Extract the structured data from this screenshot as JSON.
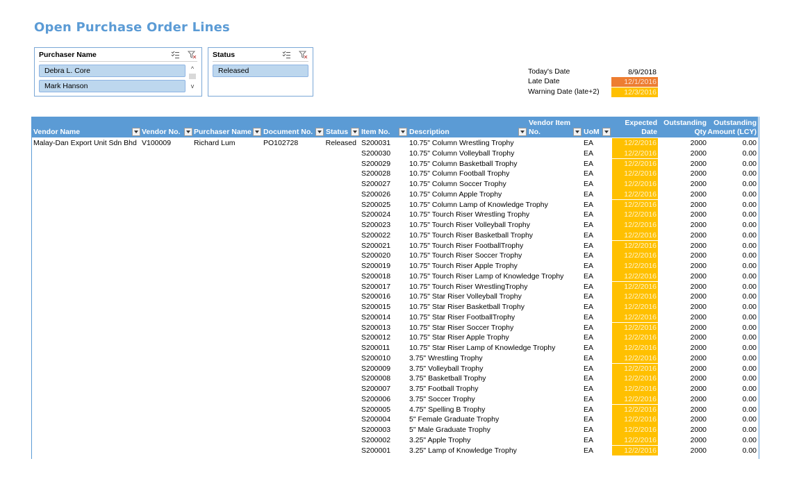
{
  "title": "Open Purchase Order Lines",
  "slicers": {
    "purchaser": {
      "header": "Purchaser Name",
      "items": [
        "Debra L. Core",
        "Mark Hanson"
      ],
      "scroll_up": "^",
      "scroll_down": "v"
    },
    "status": {
      "header": "Status",
      "items": [
        "Released"
      ]
    }
  },
  "dates": {
    "today_label": "Today's Date",
    "today_value": "8/9/2018",
    "late_label": "Late Date",
    "late_value": "12/1/2016",
    "warning_label": "Warning Date (late+2)",
    "warning_value": "12/3/2016"
  },
  "colors": {
    "header_blue": "#5b9bd5",
    "late_orange": "#ed7d31",
    "warning_yellow": "#ffc000"
  },
  "table": {
    "columns": {
      "vendor_name": "Vendor Name",
      "vendor_no": "Vendor No.",
      "purchaser_name": "Purchaser Name",
      "document_no": "Document No.",
      "status": "Status",
      "item_no": "Item No.",
      "description": "Description",
      "vendor_item_no_1": "Vendor Item",
      "vendor_item_no_2": "No.",
      "uom": "UoM",
      "expected_date_1": "Expected",
      "expected_date_2": "Date",
      "outstanding_qty_1": "Outstanding",
      "outstanding_qty_2": "Qty",
      "outstanding_amount_1": "Outstanding",
      "outstanding_amount_2": "Amount (LCY)"
    },
    "first_row": {
      "vendor_name": "Malay-Dan Export Unit Sdn Bhd",
      "vendor_no": "V100009",
      "purchaser_name": "Richard Lum",
      "document_no": "PO102728",
      "status": "Released"
    },
    "rows": [
      {
        "item": "S200031",
        "desc": "10.75\" Column Wrestling Trophy",
        "uom": "EA",
        "date": "12/2/2016",
        "qty": "2000",
        "amount": "0.00"
      },
      {
        "item": "S200030",
        "desc": "10.75\" Column Volleyball Trophy",
        "uom": "EA",
        "date": "12/2/2016",
        "qty": "2000",
        "amount": "0.00"
      },
      {
        "item": "S200029",
        "desc": "10.75\" Column Basketball Trophy",
        "uom": "EA",
        "date": "12/2/2016",
        "qty": "2000",
        "amount": "0.00"
      },
      {
        "item": "S200028",
        "desc": "10.75\" Column Football Trophy",
        "uom": "EA",
        "date": "12/2/2016",
        "qty": "2000",
        "amount": "0.00"
      },
      {
        "item": "S200027",
        "desc": "10.75\" Column Soccer Trophy",
        "uom": "EA",
        "date": "12/2/2016",
        "qty": "2000",
        "amount": "0.00"
      },
      {
        "item": "S200026",
        "desc": "10.75\" Column Apple Trophy",
        "uom": "EA",
        "date": "12/2/2016",
        "qty": "2000",
        "amount": "0.00"
      },
      {
        "item": "S200025",
        "desc": "10.75\" Column Lamp of Knowledge Trophy",
        "uom": "EA",
        "date": "12/2/2016",
        "qty": "2000",
        "amount": "0.00"
      },
      {
        "item": "S200024",
        "desc": "10.75\" Tourch Riser Wrestling Trophy",
        "uom": "EA",
        "date": "12/2/2016",
        "qty": "2000",
        "amount": "0.00"
      },
      {
        "item": "S200023",
        "desc": "10.75\" Tourch Riser Volleyball Trophy",
        "uom": "EA",
        "date": "12/2/2016",
        "qty": "2000",
        "amount": "0.00"
      },
      {
        "item": "S200022",
        "desc": "10.75\" Tourch Riser Basketball Trophy",
        "uom": "EA",
        "date": "12/2/2016",
        "qty": "2000",
        "amount": "0.00"
      },
      {
        "item": "S200021",
        "desc": "10.75\" Tourch Riser FootballTrophy",
        "uom": "EA",
        "date": "12/2/2016",
        "qty": "2000",
        "amount": "0.00"
      },
      {
        "item": "S200020",
        "desc": "10.75\" Tourch Riser Soccer Trophy",
        "uom": "EA",
        "date": "12/2/2016",
        "qty": "2000",
        "amount": "0.00"
      },
      {
        "item": "S200019",
        "desc": "10.75\" Tourch Riser Apple Trophy",
        "uom": "EA",
        "date": "12/2/2016",
        "qty": "2000",
        "amount": "0.00"
      },
      {
        "item": "S200018",
        "desc": "10.75\" Tourch Riser Lamp of Knowledge Trophy",
        "uom": "EA",
        "date": "12/2/2016",
        "qty": "2000",
        "amount": "0.00"
      },
      {
        "item": "S200017",
        "desc": "10.75\" Tourch Riser WrestlingTrophy",
        "uom": "EA",
        "date": "12/2/2016",
        "qty": "2000",
        "amount": "0.00"
      },
      {
        "item": "S200016",
        "desc": "10.75\" Star Riser Volleyball Trophy",
        "uom": "EA",
        "date": "12/2/2016",
        "qty": "2000",
        "amount": "0.00"
      },
      {
        "item": "S200015",
        "desc": "10.75\" Star Riser Basketball Trophy",
        "uom": "EA",
        "date": "12/2/2016",
        "qty": "2000",
        "amount": "0.00"
      },
      {
        "item": "S200014",
        "desc": "10.75\" Star Riser FootballTrophy",
        "uom": "EA",
        "date": "12/2/2016",
        "qty": "2000",
        "amount": "0.00"
      },
      {
        "item": "S200013",
        "desc": "10.75\" Star Riser Soccer Trophy",
        "uom": "EA",
        "date": "12/2/2016",
        "qty": "2000",
        "amount": "0.00"
      },
      {
        "item": "S200012",
        "desc": "10.75\" Star Riser Apple Trophy",
        "uom": "EA",
        "date": "12/2/2016",
        "qty": "2000",
        "amount": "0.00"
      },
      {
        "item": "S200011",
        "desc": "10.75\" Star Riser Lamp of Knowledge Trophy",
        "uom": "EA",
        "date": "12/2/2016",
        "qty": "2000",
        "amount": "0.00"
      },
      {
        "item": "S200010",
        "desc": "3.75\" Wrestling Trophy",
        "uom": "EA",
        "date": "12/2/2016",
        "qty": "2000",
        "amount": "0.00"
      },
      {
        "item": "S200009",
        "desc": "3.75\" Volleyball Trophy",
        "uom": "EA",
        "date": "12/2/2016",
        "qty": "2000",
        "amount": "0.00"
      },
      {
        "item": "S200008",
        "desc": "3.75\" Basketball Trophy",
        "uom": "EA",
        "date": "12/2/2016",
        "qty": "2000",
        "amount": "0.00"
      },
      {
        "item": "S200007",
        "desc": "3.75\" Football Trophy",
        "uom": "EA",
        "date": "12/2/2016",
        "qty": "2000",
        "amount": "0.00"
      },
      {
        "item": "S200006",
        "desc": "3.75\" Soccer Trophy",
        "uom": "EA",
        "date": "12/2/2016",
        "qty": "2000",
        "amount": "0.00"
      },
      {
        "item": "S200005",
        "desc": "4.75\" Spelling B Trophy",
        "uom": "EA",
        "date": "12/2/2016",
        "qty": "2000",
        "amount": "0.00"
      },
      {
        "item": "S200004",
        "desc": "5\" Female Graduate Trophy",
        "uom": "EA",
        "date": "12/2/2016",
        "qty": "2000",
        "amount": "0.00"
      },
      {
        "item": "S200003",
        "desc": "5\" Male Graduate Trophy",
        "uom": "EA",
        "date": "12/2/2016",
        "qty": "2000",
        "amount": "0.00"
      },
      {
        "item": "S200002",
        "desc": "3.25\" Apple Trophy",
        "uom": "EA",
        "date": "12/2/2016",
        "qty": "2000",
        "amount": "0.00"
      },
      {
        "item": "S200001",
        "desc": "3.25\" Lamp of Knowledge Trophy",
        "uom": "EA",
        "date": "12/2/2016",
        "qty": "2000",
        "amount": "0.00"
      }
    ]
  }
}
